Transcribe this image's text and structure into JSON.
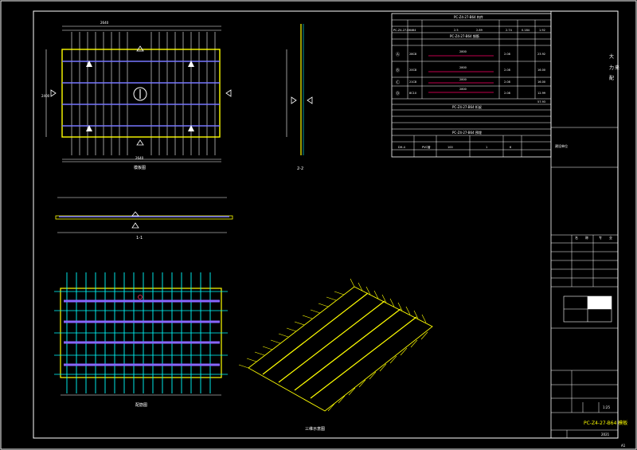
{
  "table": {
    "title1": "PC-Z4-27-B64 构件",
    "row1": [
      "PC-Z4-27-B64",
      "64",
      "2.5",
      "2.89",
      "2.74",
      "0.184",
      "1.92"
    ],
    "title2": "PC-Z4-27-B64 钢筋",
    "rebar_rows": [
      {
        "mark": "Ⓐ",
        "spec": "28C8",
        "len": "2800",
        "weight": "2.08",
        "total": "23.92"
      },
      {
        "mark": "Ⓑ",
        "spec": "20C8",
        "len": "2800",
        "weight": "2.08",
        "total": "16.00"
      },
      {
        "mark": "Ⓒ",
        "spec": "21C8",
        "len": "2800",
        "weight": "2.08",
        "total": "16.00"
      },
      {
        "mark": "Ⓓ",
        "spec": "8C10",
        "len": "2800",
        "weight": "2.08",
        "total": "12.99"
      }
    ],
    "total_value": "57.93",
    "title3": "PC-Z4-27-B64 桁架",
    "title4": "PC-Z4-27-B64 预埋",
    "last_row": [
      "DH-4",
      "PVC管",
      "100",
      "1",
      "6"
    ]
  },
  "drawings": {
    "plan_label": "模板图",
    "section_label": "1-1",
    "side_section_label": "2-2",
    "rebar_label": "配筋图",
    "iso_label": "三维示意图",
    "dim_top": "2640",
    "dim_bottom": "2640",
    "dim_side": "2400"
  },
  "title_block": {
    "company_lines": [
      "大",
      "力",
      "来",
      "配"
    ],
    "project_label": "建设单位",
    "table_header": [
      "名",
      "称",
      "专",
      "业"
    ],
    "sheet_name": "PC-Z4-27-B64 模板",
    "scale": "1:25",
    "sheet_no": "2021",
    "page": "A1"
  }
}
